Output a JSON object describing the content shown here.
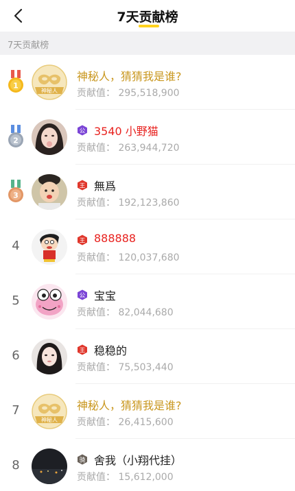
{
  "header": {
    "title": "7天贡献榜"
  },
  "section": {
    "label": "7天贡献榜"
  },
  "contribution_prefix": "贡献值：",
  "entries": [
    {
      "rank": "1",
      "name": "神秘人，猜猜我是谁?",
      "value": "295,518,900",
      "mask_label": "神秘人"
    },
    {
      "rank": "2",
      "name": "3540 小野猫",
      "value": "263,944,720",
      "badge": "公"
    },
    {
      "rank": "3",
      "name": "無爲",
      "value": "192,123,860",
      "badge": "王"
    },
    {
      "rank": "4",
      "name": "888888",
      "value": "120,037,680",
      "badge": "王"
    },
    {
      "rank": "5",
      "name": "宝宝",
      "value": "82,044,680",
      "badge": "公"
    },
    {
      "rank": "6",
      "name": "稳稳的",
      "value": "75,503,440",
      "badge": "王"
    },
    {
      "rank": "7",
      "name": "神秘人，猜猜我是谁?",
      "value": "26,415,600",
      "mask_label": "神秘人"
    },
    {
      "rank": "8",
      "name": "舍我（小翔代挂）",
      "value": "15,612,000",
      "badge": "骑"
    }
  ],
  "colors": {
    "accent_yellow": "#ffd21e",
    "mystery_gold": "#c9971f",
    "vip_red": "#e8221f",
    "badge_purple": "#7b45d6",
    "badge_red": "#e0372c",
    "badge_gray": "#6a625a"
  },
  "icons": {
    "back": "back-arrow-icon",
    "medal_gold": "gold-medal-icon",
    "medal_silver": "silver-medal-icon",
    "medal_bronze": "bronze-medal-icon"
  }
}
